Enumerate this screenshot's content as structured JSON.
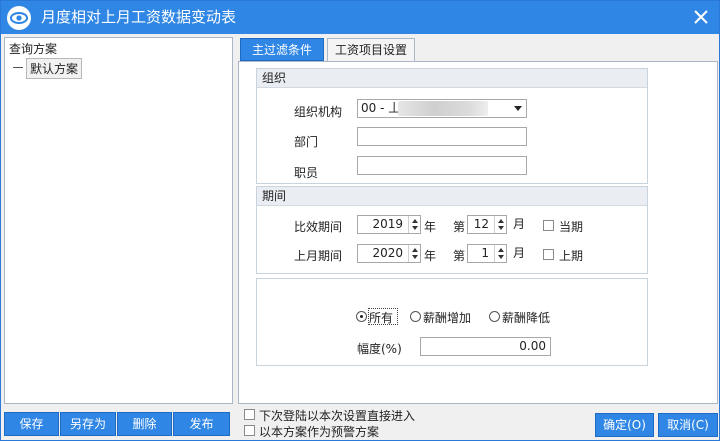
{
  "window": {
    "title": "月度相对上月工资数据变动表",
    "accent": "#2f86e4"
  },
  "left": {
    "header": "查询方案",
    "tree_item": "默认方案",
    "buttons": [
      "保存",
      "另存为",
      "删除",
      "发布"
    ]
  },
  "tabs": [
    {
      "label": "主过滤条件",
      "active": true
    },
    {
      "label": "工资项目设置",
      "active": false
    }
  ],
  "org_group": {
    "title": "组织",
    "org_label": "组织机构",
    "org_value": "00 - 丄",
    "dept_label": "部门",
    "dept_value": "",
    "emp_label": "职员",
    "emp_value": ""
  },
  "period_group": {
    "title": "期间",
    "compare_label": "比效期间",
    "compare_year": "2019",
    "compare_month": "12",
    "current_label": "当期",
    "last_label": "上月期间",
    "last_year": "2020",
    "last_month": "1",
    "prev_label": "上期",
    "year_unit": "年",
    "month_prefix": "第",
    "month_unit": "月"
  },
  "change_group": {
    "options": [
      "所有",
      "薪酬增加",
      "薪酬降低"
    ],
    "selected": 0,
    "range_label": "幅度(%)",
    "range_value": "0.00"
  },
  "footer": {
    "check1": "下次登陆以本次设置直接进入",
    "check2": "以本方案作为预警方案",
    "ok": "确定(O)",
    "cancel": "取消(C)"
  }
}
